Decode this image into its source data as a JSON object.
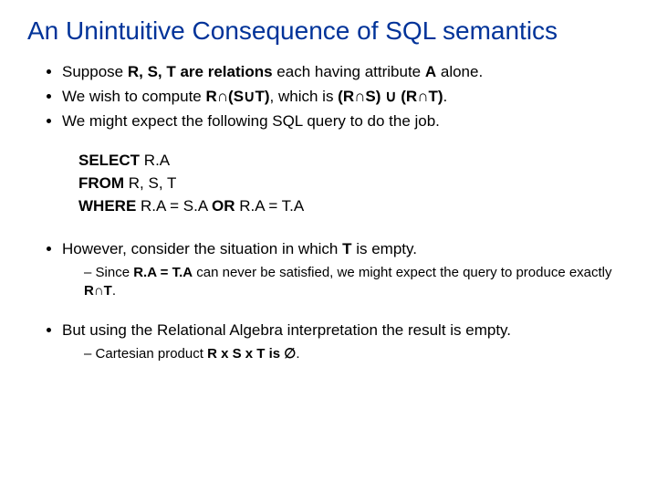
{
  "title": "An Unintuitive Consequence of SQL semantics",
  "bullets": {
    "b1_pre": "Suppose ",
    "b1_bold": "R, S, T are relations",
    "b1_mid": " each having attribute ",
    "b1_bold2": "A",
    "b1_post": " alone.",
    "b2_pre": "We wish to compute ",
    "b2_bold": "R∩(S∪T)",
    "b2_mid": ", which is ",
    "b2_bold2": "(R∩S) ∪ (R∩T)",
    "b2_post": ".",
    "b3": "We might expect the following SQL query to do the job."
  },
  "sql": {
    "l1_kw": "SELECT",
    "l1_rest": " R.A",
    "l2_kw": "FROM",
    "l2_rest": " R, S, T",
    "l3_kw": "WHERE",
    "l3_rest1": " R.A = S.A ",
    "l3_or": "OR",
    "l3_rest2": " R.A = T.A"
  },
  "bullets2": {
    "b4_pre": "However, consider the situation in which ",
    "b4_bold": "T",
    "b4_post": " is empty.",
    "b4s_pre": "Since ",
    "b4s_bold": "R.A = T.A",
    "b4s_mid": " can never be satisfied, we might expect the query to produce exactly ",
    "b4s_bold2": "R∩T",
    "b4s_post": ".",
    "b5": "But using the Relational Algebra interpretation the result is empty.",
    "b5s_pre": "Cartesian product ",
    "b5s_bold": "R x S x T is ∅",
    "b5s_post": "."
  }
}
